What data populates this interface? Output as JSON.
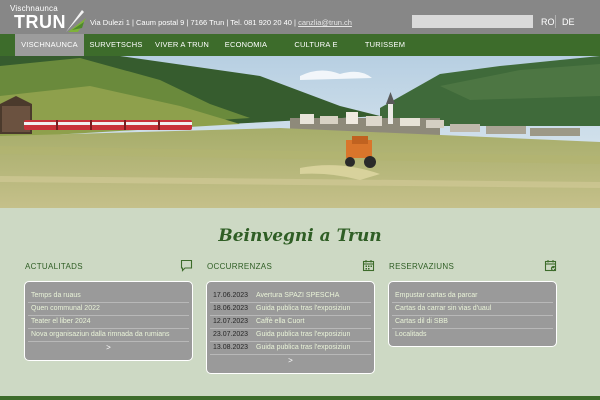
{
  "header": {
    "logo_small": "Vischnaunca",
    "logo_big": "TRUN",
    "contact": "Via Dulezi 1 | Caum postal 9 | 7166 Trun | Tel. 081 920 20 40 |",
    "email": "canzlia@trun.ch",
    "search_placeholder": "",
    "lang_ro": "RO",
    "lang_de": "DE"
  },
  "nav": {
    "items": [
      {
        "label": "VISCHNAUNCA"
      },
      {
        "label": "SURVETSCHS"
      },
      {
        "label": "VIVER A TRUN"
      },
      {
        "label": "ECONOMIA"
      },
      {
        "label": "CULTURA E SPORT"
      },
      {
        "label": "TURISSEM"
      }
    ]
  },
  "main": {
    "welcome": "Beinvegni a Trun"
  },
  "actualitads": {
    "title": "ACTUALITADS",
    "icon": "chat-icon",
    "items": [
      "Temps da ruaus",
      "Quen communal 2022",
      "Teater el liber 2024",
      "Nova organisaziun dalla rimnada da rumians"
    ],
    "more": ">"
  },
  "occurrenzas": {
    "title": "OCCURRENZAS",
    "icon": "calendar-icon",
    "items": [
      {
        "date": "17.06.2023",
        "event": "Avertura SPAZI SPESCHA"
      },
      {
        "date": "18.06.2023",
        "event": "Guida publica tras l'exposiziun"
      },
      {
        "date": "12.07.2023",
        "event": "Caffè ella Cuort"
      },
      {
        "date": "23.07.2023",
        "event": "Guida publica tras l'exposiziun"
      },
      {
        "date": "13.08.2023",
        "event": "Guida publica tras l'exposiziun"
      }
    ],
    "more": ">"
  },
  "reservaziuns": {
    "title": "RESERVAZIUNS",
    "icon": "calendar-check-icon",
    "items": [
      "Empustar cartas da parcar",
      "Cartas da carrar sin vias d'uaul",
      "Cartas dil di SBB",
      "Localitads"
    ]
  },
  "colors": {
    "nav_green": "#3d6c2b",
    "header_gray": "#878787",
    "page_bg": "#cdd9c4",
    "panel_gray": "#9a9a9a"
  }
}
